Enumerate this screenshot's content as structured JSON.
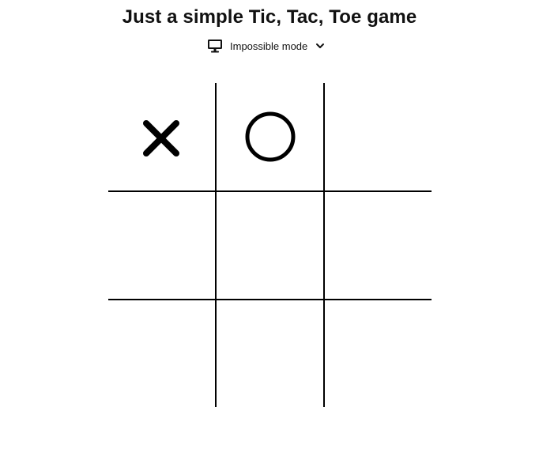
{
  "header": {
    "title": "Just a simple Tic, Tac, Toe game"
  },
  "mode_selector": {
    "icon": "monitor-icon",
    "selected": "Impossible mode",
    "chevron_icon": "chevron-down-icon"
  },
  "board": {
    "rows": 3,
    "cols": 3,
    "cells": [
      "X",
      "O",
      "",
      "",
      "",
      "",
      "",
      "",
      ""
    ],
    "line_color": "#000000",
    "mark_color": "#000000"
  }
}
